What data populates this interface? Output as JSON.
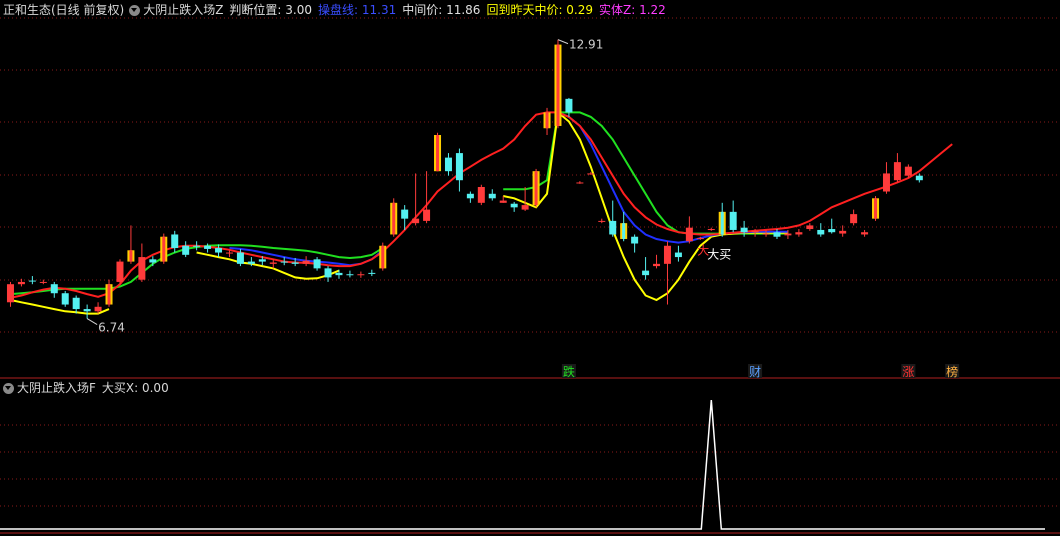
{
  "header": {
    "stock_title": "正和生态(日线 前复权)",
    "indicator_name": "大阴止跌入场Z",
    "items": [
      {
        "label": "判断位置: 3.00",
        "color": "#e0e0e0"
      },
      {
        "label": "操盘线: 11.31",
        "color": "#3a4dff"
      },
      {
        "label": "中间价: 11.86",
        "color": "#e0e0e0"
      },
      {
        "label": "回到昨天中价: 0.29",
        "color": "#ffff00"
      },
      {
        "label": "实体Z: 1.22",
        "color": "#ff3cff"
      }
    ]
  },
  "sub_header": {
    "indicator_name": "大阴止跌入场F",
    "value_label": "大买X: 0.00"
  },
  "colors": {
    "up": "#ff3b3b",
    "down": "#54f0f0",
    "accent_bar": "#ffd000",
    "red_line": "#ff2020",
    "blue_line": "#2030ff",
    "green_line": "#20e020",
    "yellow_line": "#ffff00",
    "grid": "#8a1a1a"
  },
  "chart_data": {
    "type": "candlestick",
    "price_range": [
      6.0,
      13.3
    ],
    "annotations": {
      "high_label": "12.91",
      "low_label": "6.74",
      "buy_label_1": "大",
      "buy_label_2": "大买"
    },
    "bottom_tags": [
      {
        "text": "跌",
        "color": "#20e020",
        "index": 51
      },
      {
        "text": "财",
        "color": "#5aa0ff",
        "index": 68
      },
      {
        "text": "涨",
        "color": "#ff3030",
        "index": 82
      },
      {
        "text": "榜",
        "color": "#ffb040",
        "index": 86
      }
    ],
    "candles": [
      {
        "o": 7.1,
        "c": 7.5,
        "h": 7.55,
        "l": 7.0
      },
      {
        "o": 7.5,
        "c": 7.55,
        "h": 7.62,
        "l": 7.45
      },
      {
        "o": 7.58,
        "c": 7.56,
        "h": 7.68,
        "l": 7.5
      },
      {
        "o": 7.55,
        "c": 7.55,
        "h": 7.6,
        "l": 7.5
      },
      {
        "o": 7.5,
        "c": 7.3,
        "h": 7.55,
        "l": 7.2
      },
      {
        "o": 7.3,
        "c": 7.05,
        "h": 7.35,
        "l": 7.0
      },
      {
        "o": 7.2,
        "c": 6.95,
        "h": 7.25,
        "l": 6.85
      },
      {
        "o": 6.95,
        "c": 6.9,
        "h": 7.05,
        "l": 6.74
      },
      {
        "o": 6.9,
        "c": 7.0,
        "h": 7.1,
        "l": 6.85
      },
      {
        "o": 7.05,
        "c": 7.5,
        "h": 7.6,
        "l": 7.0,
        "y": true
      },
      {
        "o": 7.55,
        "c": 8.0,
        "h": 8.05,
        "l": 7.5
      },
      {
        "o": 8.0,
        "c": 8.25,
        "h": 8.8,
        "l": 7.95,
        "y": true
      },
      {
        "o": 7.6,
        "c": 8.1,
        "h": 8.4,
        "l": 7.55
      },
      {
        "o": 8.05,
        "c": 7.98,
        "h": 8.12,
        "l": 7.9
      },
      {
        "o": 8.0,
        "c": 8.55,
        "h": 8.62,
        "l": 7.95,
        "y": true
      },
      {
        "o": 8.6,
        "c": 8.3,
        "h": 8.68,
        "l": 8.2
      },
      {
        "o": 8.35,
        "c": 8.15,
        "h": 8.45,
        "l": 8.1
      },
      {
        "o": 8.35,
        "c": 8.33,
        "h": 8.45,
        "l": 8.25
      },
      {
        "o": 8.35,
        "c": 8.28,
        "h": 8.4,
        "l": 8.2
      },
      {
        "o": 8.3,
        "c": 8.2,
        "h": 8.38,
        "l": 8.1
      },
      {
        "o": 8.18,
        "c": 8.2,
        "h": 8.25,
        "l": 8.1
      },
      {
        "o": 8.2,
        "c": 7.95,
        "h": 8.28,
        "l": 7.9
      },
      {
        "o": 8.0,
        "c": 7.95,
        "h": 8.1,
        "l": 7.9
      },
      {
        "o": 8.05,
        "c": 8.0,
        "h": 8.12,
        "l": 7.92
      },
      {
        "o": 7.95,
        "c": 7.98,
        "h": 8.05,
        "l": 7.85
      },
      {
        "o": 8.0,
        "c": 7.98,
        "h": 8.1,
        "l": 7.92
      },
      {
        "o": 7.98,
        "c": 7.95,
        "h": 8.08,
        "l": 7.9
      },
      {
        "o": 7.95,
        "c": 8.02,
        "h": 8.12,
        "l": 7.9
      },
      {
        "o": 8.05,
        "c": 7.85,
        "h": 8.1,
        "l": 7.8
      },
      {
        "o": 7.85,
        "c": 7.65,
        "h": 7.9,
        "l": 7.55
      },
      {
        "o": 7.75,
        "c": 7.7,
        "h": 7.82,
        "l": 7.62
      },
      {
        "o": 7.72,
        "c": 7.7,
        "h": 7.8,
        "l": 7.65
      },
      {
        "o": 7.7,
        "c": 7.72,
        "h": 7.78,
        "l": 7.64
      },
      {
        "o": 7.75,
        "c": 7.73,
        "h": 7.82,
        "l": 7.68
      },
      {
        "o": 7.85,
        "c": 8.35,
        "h": 8.42,
        "l": 7.8,
        "y": true
      },
      {
        "o": 8.6,
        "c": 9.3,
        "h": 9.4,
        "l": 8.55,
        "y": true
      },
      {
        "o": 9.15,
        "c": 8.95,
        "h": 9.25,
        "l": 8.7
      },
      {
        "o": 8.85,
        "c": 8.95,
        "h": 9.95,
        "l": 8.8
      },
      {
        "o": 8.9,
        "c": 9.15,
        "h": 10.0,
        "l": 8.85
      },
      {
        "o": 10.0,
        "c": 10.8,
        "h": 10.85,
        "l": 10.0,
        "y": true
      },
      {
        "o": 10.3,
        "c": 10.0,
        "h": 10.4,
        "l": 9.9
      },
      {
        "o": 10.4,
        "c": 9.8,
        "h": 10.5,
        "l": 9.55
      },
      {
        "o": 9.5,
        "c": 9.4,
        "h": 9.55,
        "l": 9.3
      },
      {
        "o": 9.3,
        "c": 9.65,
        "h": 9.7,
        "l": 9.25
      },
      {
        "o": 9.5,
        "c": 9.4,
        "h": 9.6,
        "l": 9.35
      },
      {
        "o": 9.3,
        "c": 9.35,
        "h": 9.45,
        "l": 9.3
      },
      {
        "o": 9.28,
        "c": 9.2,
        "h": 9.32,
        "l": 9.1
      },
      {
        "o": 9.15,
        "c": 9.25,
        "h": 9.65,
        "l": 9.12
      },
      {
        "o": 9.25,
        "c": 10.0,
        "h": 10.05,
        "l": 9.2,
        "y": true
      },
      {
        "o": 10.95,
        "c": 11.3,
        "h": 11.4,
        "l": 10.8,
        "y": true
      },
      {
        "o": 11.0,
        "c": 12.8,
        "h": 12.91,
        "l": 10.95,
        "y": true
      },
      {
        "o": 11.6,
        "c": 11.3,
        "h": 11.62,
        "l": 11.2
      },
      {
        "o": 9.75,
        "c": 9.75,
        "h": 9.78,
        "l": 9.72
      },
      {
        "o": 9.95,
        "c": 9.95,
        "h": 9.98,
        "l": 9.92
      },
      {
        "o": 8.9,
        "c": 8.9,
        "h": 8.95,
        "l": 8.85
      },
      {
        "o": 8.9,
        "c": 8.6,
        "h": 9.35,
        "l": 8.55
      },
      {
        "o": 8.85,
        "c": 8.5,
        "h": 9.1,
        "l": 8.45,
        "y": true
      },
      {
        "o": 8.55,
        "c": 8.4,
        "h": 8.6,
        "l": 8.2
      },
      {
        "o": 7.8,
        "c": 7.7,
        "h": 8.1,
        "l": 7.6
      },
      {
        "o": 7.9,
        "c": 7.95,
        "h": 8.15,
        "l": 7.85
      },
      {
        "o": 7.95,
        "c": 8.35,
        "h": 8.45,
        "l": 7.05
      },
      {
        "o": 8.2,
        "c": 8.1,
        "h": 8.35,
        "l": 8.0
      },
      {
        "o": 8.45,
        "c": 8.75,
        "h": 9.0,
        "l": 8.4
      },
      {
        "o": 8.5,
        "c": 8.52,
        "h": 8.55,
        "l": 8.48
      },
      {
        "o": 8.7,
        "c": 8.72,
        "h": 8.75,
        "l": 8.68
      },
      {
        "o": 9.1,
        "c": 8.6,
        "h": 9.3,
        "l": 8.55,
        "y": true
      },
      {
        "o": 9.1,
        "c": 8.7,
        "h": 9.35,
        "l": 8.65
      },
      {
        "o": 8.75,
        "c": 8.65,
        "h": 8.9,
        "l": 8.55
      },
      {
        "o": 8.65,
        "c": 8.68,
        "h": 8.72,
        "l": 8.55
      },
      {
        "o": 8.6,
        "c": 8.62,
        "h": 8.7,
        "l": 8.55
      },
      {
        "o": 8.65,
        "c": 8.55,
        "h": 8.72,
        "l": 8.5
      },
      {
        "o": 8.58,
        "c": 8.62,
        "h": 8.7,
        "l": 8.5
      },
      {
        "o": 8.6,
        "c": 8.65,
        "h": 8.72,
        "l": 8.55
      },
      {
        "o": 8.72,
        "c": 8.8,
        "h": 8.85,
        "l": 8.68
      },
      {
        "o": 8.7,
        "c": 8.6,
        "h": 8.85,
        "l": 8.55
      },
      {
        "o": 8.72,
        "c": 8.65,
        "h": 8.95,
        "l": 8.62
      },
      {
        "o": 8.62,
        "c": 8.68,
        "h": 8.8,
        "l": 8.55
      },
      {
        "o": 8.85,
        "c": 9.05,
        "h": 9.15,
        "l": 8.8
      },
      {
        "o": 8.6,
        "c": 8.65,
        "h": 8.7,
        "l": 8.55
      },
      {
        "o": 8.95,
        "c": 9.4,
        "h": 9.45,
        "l": 8.9,
        "y": true
      },
      {
        "o": 9.55,
        "c": 9.95,
        "h": 10.2,
        "l": 9.5
      },
      {
        "o": 9.8,
        "c": 10.2,
        "h": 10.4,
        "l": 9.75
      },
      {
        "o": 9.9,
        "c": 10.1,
        "h": 10.15,
        "l": 9.85
      },
      {
        "o": 9.9,
        "c": 9.8,
        "h": 9.95,
        "l": 9.75
      }
    ],
    "lines": {
      "red": [
        7.2,
        7.25,
        7.32,
        7.38,
        7.42,
        7.4,
        7.35,
        7.28,
        7.22,
        7.3,
        7.5,
        7.8,
        8.02,
        8.15,
        8.25,
        8.32,
        8.35,
        8.35,
        8.33,
        8.3,
        8.26,
        8.2,
        8.15,
        8.1,
        8.05,
        8.0,
        7.98,
        7.97,
        7.95,
        7.92,
        7.9,
        7.9,
        7.95,
        8.05,
        8.22,
        8.45,
        8.7,
        8.98,
        9.25,
        9.55,
        9.75,
        9.95,
        10.1,
        10.25,
        10.38,
        10.5,
        10.7,
        11.0,
        11.25,
        11.3,
        11.3,
        11.2,
        11.0,
        10.7,
        10.3,
        9.9,
        9.5,
        9.2,
        8.98,
        8.82,
        8.72,
        8.65,
        8.62,
        8.6,
        8.6,
        8.62,
        8.64,
        8.66,
        8.68,
        8.7,
        8.72,
        8.75,
        8.8,
        8.9,
        9.05,
        9.2,
        9.3,
        9.4,
        9.5,
        9.58,
        9.66,
        9.75,
        9.85,
        10.0,
        10.2,
        10.4,
        10.6
      ],
      "blue": [
        null,
        null,
        null,
        null,
        null,
        null,
        null,
        null,
        null,
        null,
        null,
        null,
        null,
        null,
        null,
        null,
        null,
        null,
        null,
        null,
        8.3,
        8.28,
        8.25,
        8.2,
        8.15,
        8.1,
        8.05,
        8.02,
        8.0,
        7.98,
        7.95,
        7.92,
        7.95,
        8.05,
        8.25,
        null,
        null,
        null,
        null,
        null,
        null,
        null,
        null,
        null,
        null,
        null,
        null,
        null,
        null,
        null,
        11.3,
        11.2,
        11.0,
        10.6,
        10.1,
        9.6,
        9.1,
        8.8,
        8.6,
        8.5,
        8.45,
        8.42,
        8.45,
        8.52,
        8.58,
        8.62,
        8.64,
        8.65,
        8.66,
        8.66,
        8.66,
        8.66,
        null,
        null,
        null,
        null,
        null,
        null,
        null,
        null,
        null,
        null,
        null,
        null,
        null,
        null,
        null
      ],
      "green": [
        7.28,
        7.3,
        7.32,
        7.35,
        7.38,
        7.4,
        7.4,
        7.4,
        7.4,
        7.4,
        7.45,
        7.55,
        7.75,
        7.95,
        8.1,
        8.2,
        8.28,
        8.32,
        8.35,
        8.36,
        8.36,
        8.36,
        8.35,
        8.33,
        8.3,
        8.28,
        8.26,
        8.24,
        8.2,
        8.15,
        8.1,
        8.08,
        8.1,
        8.15,
        8.3,
        null,
        null,
        null,
        null,
        null,
        null,
        null,
        null,
        null,
        null,
        9.6,
        9.6,
        9.6,
        9.65,
        9.8,
        11.3,
        11.3,
        11.3,
        11.2,
        11.0,
        10.7,
        10.3,
        9.9,
        9.5,
        9.1,
        8.8,
        8.65,
        8.62,
        8.62,
        8.62,
        8.62,
        8.62,
        8.62,
        8.62,
        8.62,
        8.62,
        8.62,
        null,
        null,
        null,
        null,
        null,
        null,
        null,
        null,
        null,
        null,
        null,
        null,
        null,
        null,
        null
      ],
      "yellow": [
        7.15,
        7.1,
        7.05,
        7.0,
        6.95,
        6.9,
        6.88,
        6.85,
        6.85,
        6.95,
        null,
        null,
        null,
        null,
        null,
        null,
        null,
        8.2,
        8.15,
        8.1,
        8.05,
        7.98,
        7.95,
        7.9,
        7.85,
        7.75,
        7.65,
        7.62,
        7.63,
        7.7,
        7.8,
        null,
        null,
        null,
        null,
        null,
        null,
        null,
        null,
        null,
        null,
        null,
        null,
        null,
        null,
        9.45,
        9.4,
        9.3,
        9.2,
        9.5,
        11.3,
        11.1,
        10.7,
        10.1,
        9.4,
        8.7,
        8.1,
        7.6,
        7.25,
        7.15,
        7.3,
        7.6,
        8.0,
        8.35,
        8.55,
        8.6,
        8.62,
        8.64,
        8.64,
        8.64,
        8.64,
        8.64,
        null,
        null,
        null,
        null,
        null,
        null,
        null,
        null,
        null,
        null,
        null,
        null,
        null,
        null,
        null
      ]
    },
    "indicator": {
      "name": "大买X",
      "range": [
        0,
        1
      ],
      "values": [
        0,
        0,
        0,
        0,
        0,
        0,
        0,
        0,
        0,
        0,
        0,
        0,
        0,
        0,
        0,
        0,
        0,
        0,
        0,
        0,
        0,
        0,
        0,
        0,
        0,
        0,
        0,
        0,
        0,
        0,
        0,
        0,
        0,
        0,
        0,
        0,
        0,
        0,
        0,
        0,
        0,
        0,
        0,
        0,
        0,
        0,
        0,
        0,
        0,
        0,
        0,
        0,
        0,
        0,
        0,
        0,
        0,
        0,
        0,
        0,
        0,
        0,
        0,
        0,
        1,
        0,
        0,
        0,
        0,
        0,
        0,
        0,
        0,
        0,
        0,
        0,
        0,
        0,
        0,
        0,
        0,
        0,
        0,
        0,
        0,
        0,
        0
      ]
    }
  }
}
